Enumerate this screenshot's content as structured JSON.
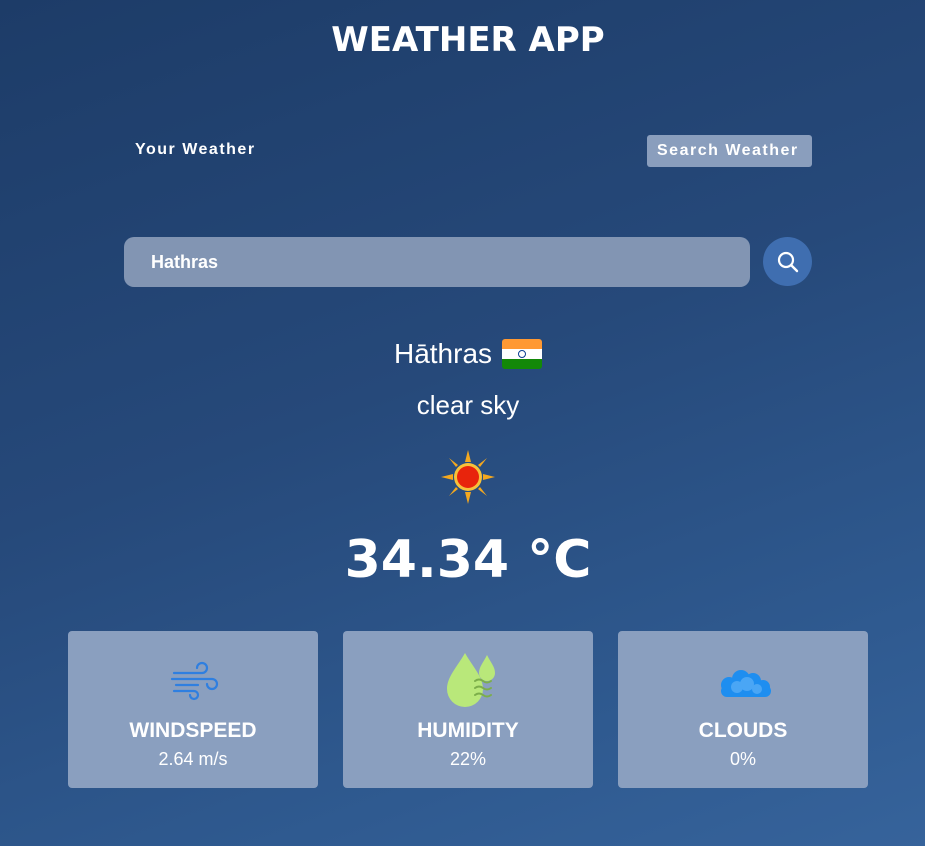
{
  "header": {
    "title": "WEATHER APP"
  },
  "tabs": {
    "your_weather": "Your Weather",
    "search_weather": "Search Weather"
  },
  "search": {
    "value": "Hathras"
  },
  "weather": {
    "city": "Hāthras",
    "country_flag": "india-flag-icon",
    "description": "clear sky",
    "condition_icon": "sun-icon",
    "temperature": "34.34 °C"
  },
  "cards": {
    "windspeed": {
      "icon": "wind-icon",
      "title": "WINDSPEED",
      "value": "2.64 m/s"
    },
    "humidity": {
      "icon": "humidity-icon",
      "title": "HUMIDITY",
      "value": "22%"
    },
    "clouds": {
      "icon": "clouds-icon",
      "title": "CLOUDS",
      "value": "0%"
    }
  },
  "colors": {
    "background_top": "#1d3c68",
    "background_bottom": "#36639b",
    "search_bar": "#8295b3",
    "search_button": "#3f6eb0",
    "card_bg": "#8a9fbf",
    "active_tab": "#8a9ebd"
  }
}
